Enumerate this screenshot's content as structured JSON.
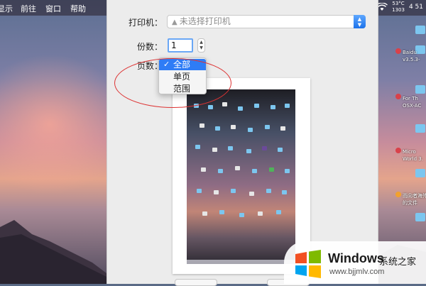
{
  "menubar": {
    "items": [
      "显示",
      "前往",
      "窗口",
      "帮助"
    ],
    "temp_line1": "53°C",
    "temp_line2": "1303",
    "clock_partial": "4 51"
  },
  "desktop_labels": [
    "Baidu",
    "v3.5.3-",
    "For Th",
    "OSX-AC",
    "Micro",
    "World 3.",
    "而向者海外",
    "的文件"
  ],
  "print_dialog": {
    "printer_label": "打印机：",
    "printer_value": "未选择打印机",
    "copies_label": "份数：",
    "copies_value": "1",
    "pages_label": "页数：",
    "pages_options": [
      "全部",
      "单页",
      "范围"
    ],
    "pages_selected": "全部"
  },
  "watermark": {
    "brand": "Windows",
    "cn_text": "系统之家",
    "url": "www.bjjmlv.com"
  },
  "colors": {
    "accent": "#2e7cf6",
    "annotation": "#d33333"
  }
}
